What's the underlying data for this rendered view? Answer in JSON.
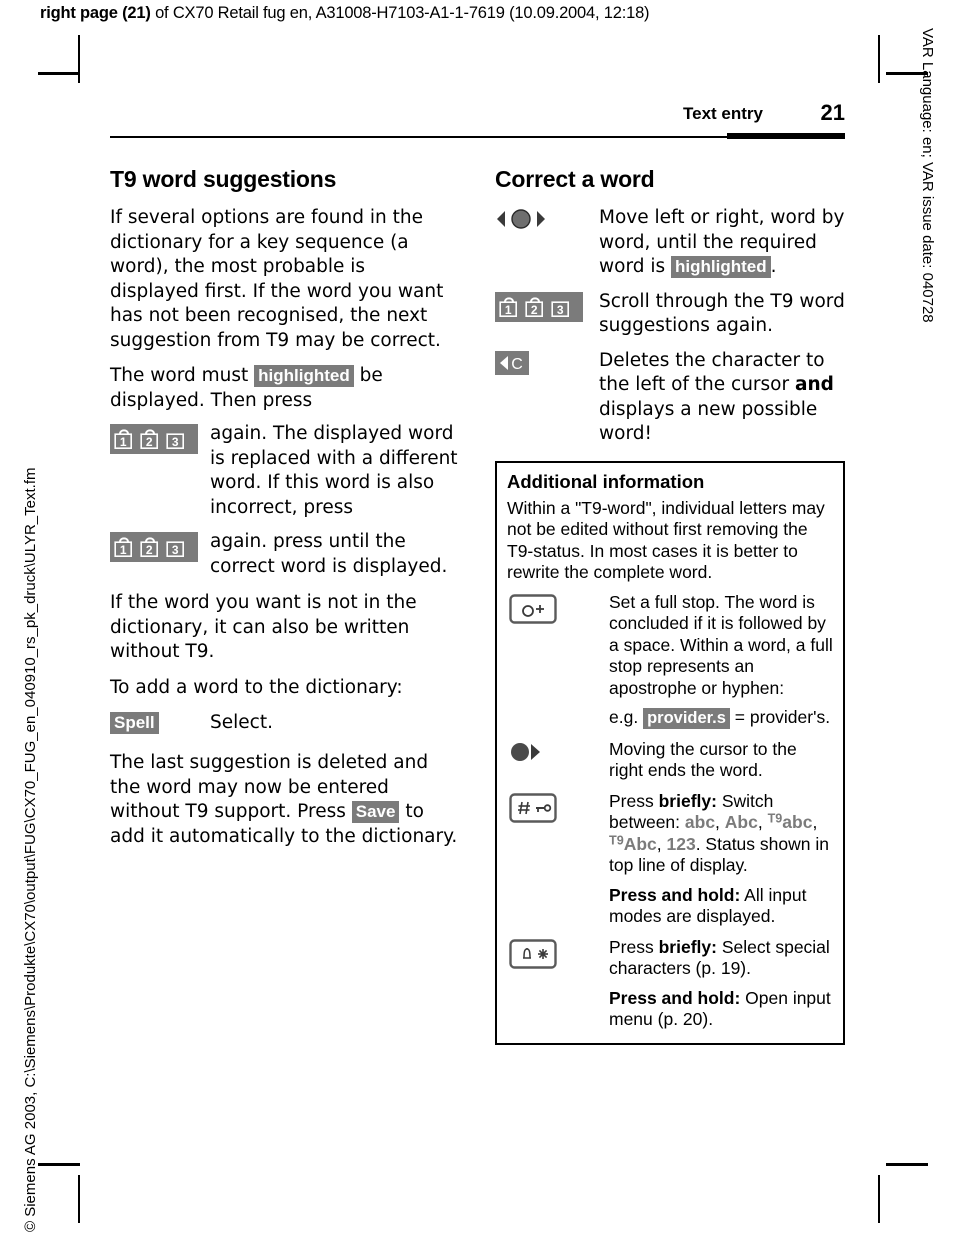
{
  "print_header": {
    "bold": "right page (21)",
    "rest": " of CX70 Retail fug en, A31008-H7103-A1-1-7619 (10.09.2004, 12:18)"
  },
  "margins": {
    "left_note": "© Siemens AG 2003, C:\\Siemens\\Produkte\\CX70\\output\\FUG\\CX70_FUG_en_040910_rs_pk_druck\\ULYR_Text.fm",
    "right_note": "VAR Language: en; VAR issue date: 040728"
  },
  "running_head": {
    "title": "Text entry",
    "page_number": "21"
  },
  "colors": {
    "highlight_gray": "#7b7b7b",
    "key_outline": "#5a5a5a",
    "text": "#000000"
  },
  "left_column": {
    "heading": "T9 word suggestions",
    "para1": "If several options are found in the dictionary for a key sequence (a word), the most probable is displayed first. If the word you want has not been recognised, the next suggestion from T9 may be correct.",
    "para2_before": "The word must ",
    "para2_highlight": "highlighted",
    "para2_after": " be displayed. Then press",
    "rows": [
      {
        "icon": "keys-1-2-3-icon",
        "text": "again. The displayed word is replaced with a different word. If this word is also incorrect, press"
      },
      {
        "icon": "keys-1-2-3-icon",
        "text": "again. press until the correct word is displayed."
      }
    ],
    "para3": "If the word you want is not in the dictionary, it can also be written without T9.",
    "para4": "To add a word to the dictionary:",
    "spell_row": {
      "label": "Spell",
      "text": "Select."
    },
    "para5_before": "The last suggestion is deleted and the word may now be entered without T9 support. Press ",
    "para5_highlight": "Save",
    "para5_after": " to add it automatically to the dictionary."
  },
  "right_column": {
    "heading": "Correct a word",
    "rows": [
      {
        "icon": "nav-left-right-icon",
        "text_before": "Move left or right, word by word, until the required word is ",
        "text_highlight": "highlighted",
        "text_after": "."
      },
      {
        "icon": "keys-1-2-3-icon",
        "text": "Scroll through the T9 word suggestions again."
      },
      {
        "icon": "clear-key-icon",
        "text_before": "Deletes the character to the left of the cursor ",
        "text_bold": "and",
        "text_after": " displays a new possible word!"
      }
    ]
  },
  "infobox": {
    "heading": "Additional information",
    "intro": "Within a \"T9-word\", individual letters may not be edited without first removing the T9-status. In most cases it is better to rewrite the complete word.",
    "rows": [
      {
        "icon": "key-0-plus-icon",
        "text": "Set a full stop. The word is concluded if it is followed by a space. Within a word, a full stop represents an apostrophe or hyphen:",
        "example_before": "e.g. ",
        "example_highlight": "provider.s",
        "example_after": " = provider's."
      },
      {
        "icon": "nav-right-icon",
        "text": "Moving the cursor to the right ends the word."
      },
      {
        "icon": "key-hash-icon",
        "press_briefly_label": "Press ",
        "press_briefly_bold": "briefly:",
        "press_briefly_text": " Switch between: ",
        "modes": [
          "abc",
          "Abc",
          "T9abc",
          "T9Abc",
          "123"
        ],
        "press_briefly_tail": ". Status shown in top line of display.",
        "hold_bold": "Press and hold:",
        "hold_text": " All input modes are displayed."
      },
      {
        "icon": "key-star-icon",
        "press_briefly_label": "Press ",
        "press_briefly_bold": "briefly:",
        "press_briefly_text": " Select special characters (p. 19).",
        "hold_bold": "Press and hold:",
        "hold_text": " Open input menu (p. 20)."
      }
    ]
  }
}
